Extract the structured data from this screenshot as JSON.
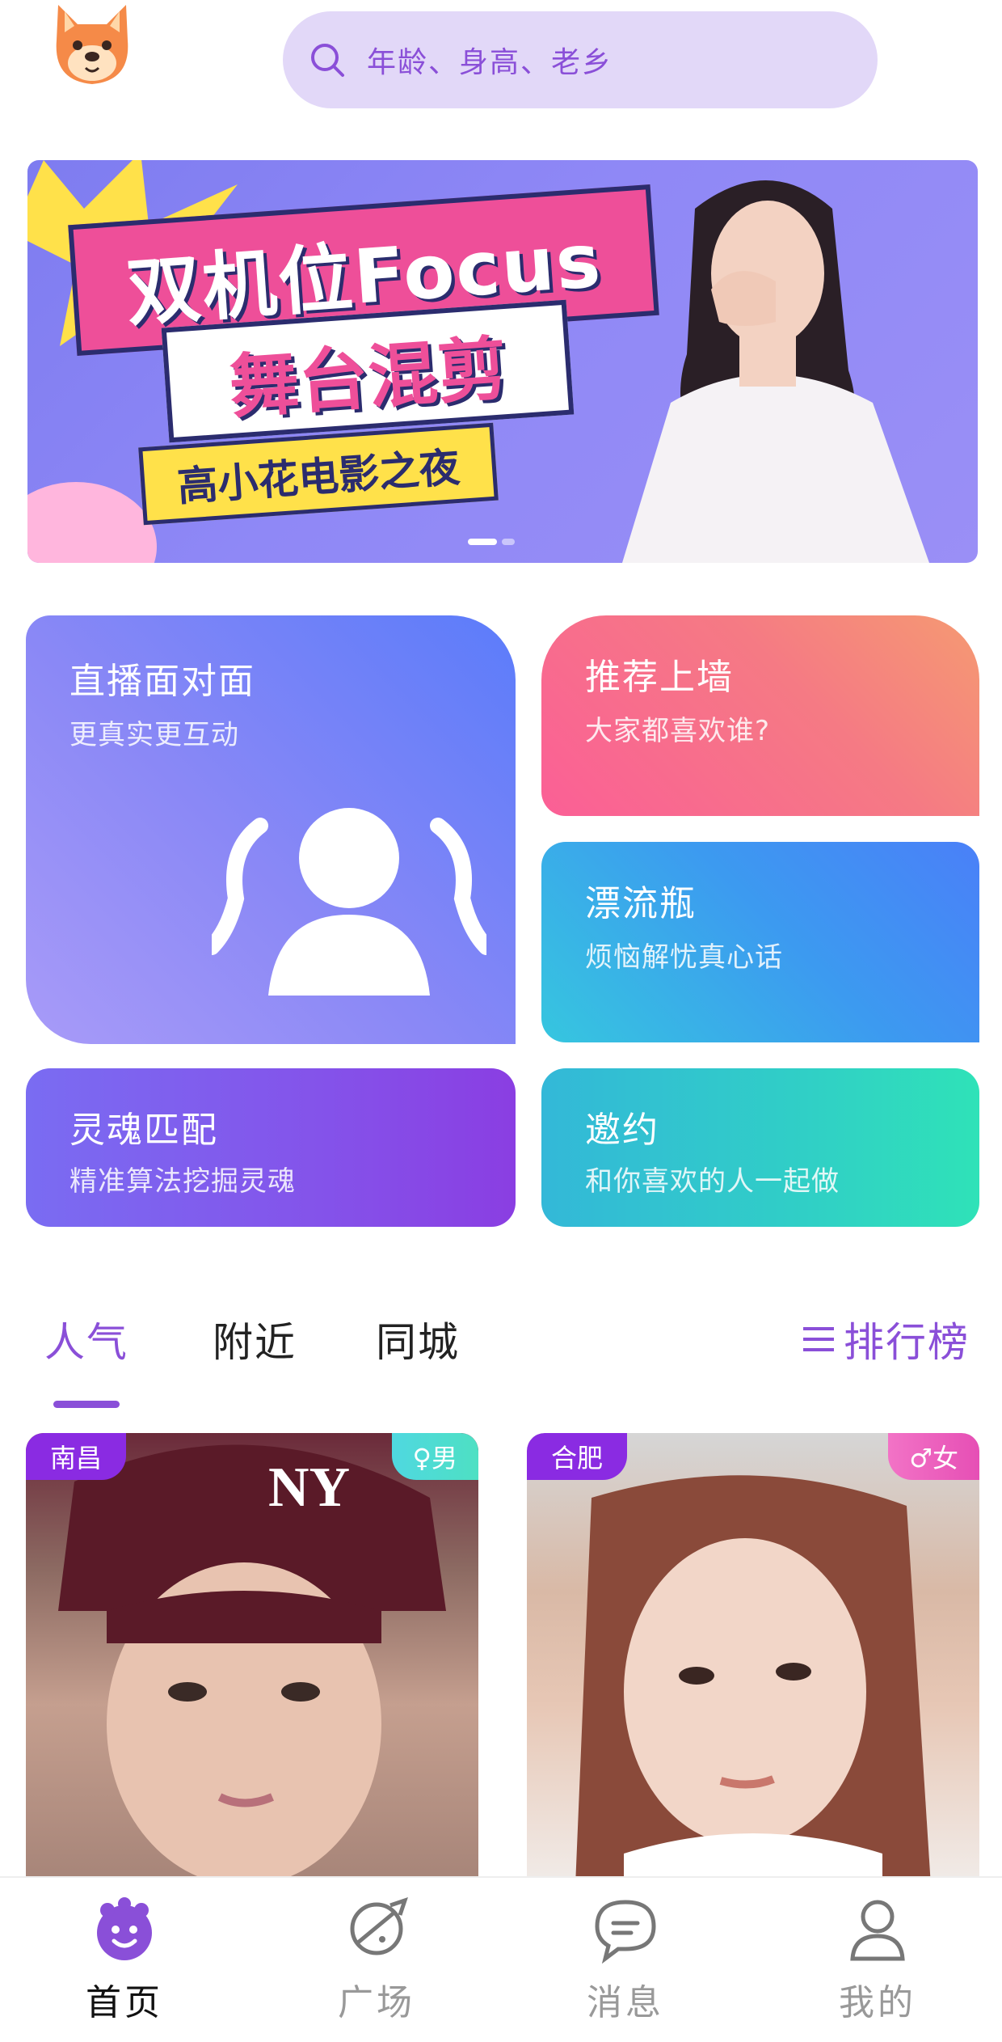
{
  "header": {
    "search_placeholder": "年龄、身高、老乡"
  },
  "banner": {
    "line1": "双机位Focus",
    "line2": "舞台混剪",
    "line3": "高小花电影之夜"
  },
  "features": {
    "live": {
      "title": "直播面对面",
      "subtitle": "更真实更互动"
    },
    "recommend": {
      "title": "推荐上墙",
      "subtitle": "大家都喜欢谁?"
    },
    "bottle": {
      "title": "漂流瓶",
      "subtitle": "烦恼解忧真心话"
    },
    "soul": {
      "title": "灵魂匹配",
      "subtitle": "精准算法挖掘灵魂"
    },
    "date": {
      "title": "邀约",
      "subtitle": "和你喜欢的人一起做"
    }
  },
  "tabs": {
    "items": [
      {
        "label": "人气"
      },
      {
        "label": "附近"
      },
      {
        "label": "同城"
      }
    ],
    "ranking_label": "排行榜"
  },
  "users": [
    {
      "city": "南昌",
      "gender": "♀男"
    },
    {
      "city": "合肥",
      "gender": "♂女"
    }
  ],
  "nav": {
    "items": [
      {
        "label": "首页"
      },
      {
        "label": "广场"
      },
      {
        "label": "消息"
      },
      {
        "label": "我的"
      }
    ]
  },
  "colors": {
    "accent": "#8a4fd8",
    "search_bg": "#e2d8f8"
  }
}
